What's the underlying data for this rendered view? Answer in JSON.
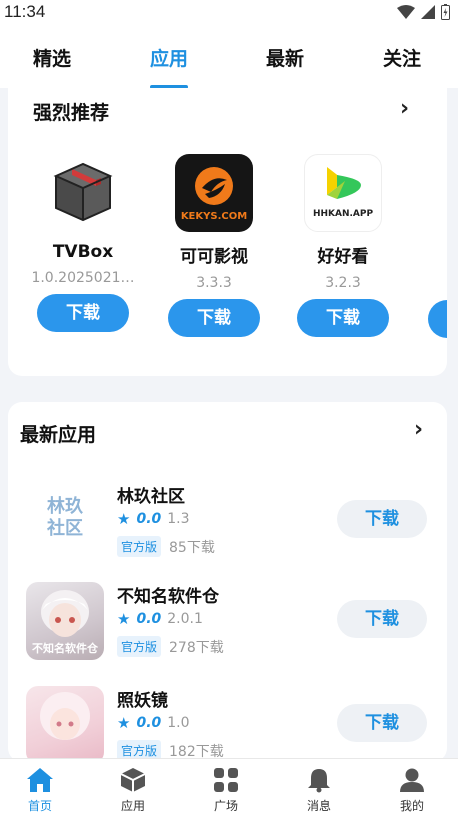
{
  "status": {
    "time": "11:34"
  },
  "tabs": [
    "精选",
    "应用",
    "最新",
    "关注"
  ],
  "recommend": {
    "title": "强烈推荐",
    "apps": [
      {
        "name": "TVBox",
        "version": "1.0.2025021…",
        "button": "下载",
        "icon": "box-icon"
      },
      {
        "name": "可可影视",
        "version": "3.3.3",
        "button": "下载",
        "icon": "kekys-logo",
        "icon_text": "KEKYS.COM"
      },
      {
        "name": "好好看",
        "version": "3.2.3",
        "button": "下载",
        "icon": "hhkan-logo",
        "icon_text": "HHKAN.APP"
      }
    ]
  },
  "latest": {
    "title": "最新应用",
    "items": [
      {
        "name": "林玖社区",
        "rating": "0.0",
        "version": "1.3",
        "badge": "官方版",
        "downloads": "85下载",
        "button": "下载",
        "thumb": "linjiu-logo",
        "thumb_text": "林玖社区"
      },
      {
        "name": "不知名软件仓",
        "rating": "0.0",
        "version": "2.0.1",
        "badge": "官方版",
        "downloads": "278下载",
        "button": "下载",
        "thumb": "anime-avatar",
        "thumb_text": "不知名软件仓"
      },
      {
        "name": "照妖镜",
        "rating": "0.0",
        "version": "1.0",
        "badge": "官方版",
        "downloads": "182下载",
        "button": "下载",
        "thumb": "anime-avatar-pink"
      }
    ]
  },
  "bottom_nav": [
    {
      "label": "首页",
      "icon": "home-icon",
      "active": true
    },
    {
      "label": "应用",
      "icon": "cube-icon"
    },
    {
      "label": "广场",
      "icon": "grid-icon"
    },
    {
      "label": "消息",
      "icon": "bell-icon"
    },
    {
      "label": "我的",
      "icon": "user-icon"
    }
  ],
  "colors": {
    "accent": "#1e90e0",
    "button_blue": "#2b96ec",
    "background": "#f2f4f8"
  }
}
